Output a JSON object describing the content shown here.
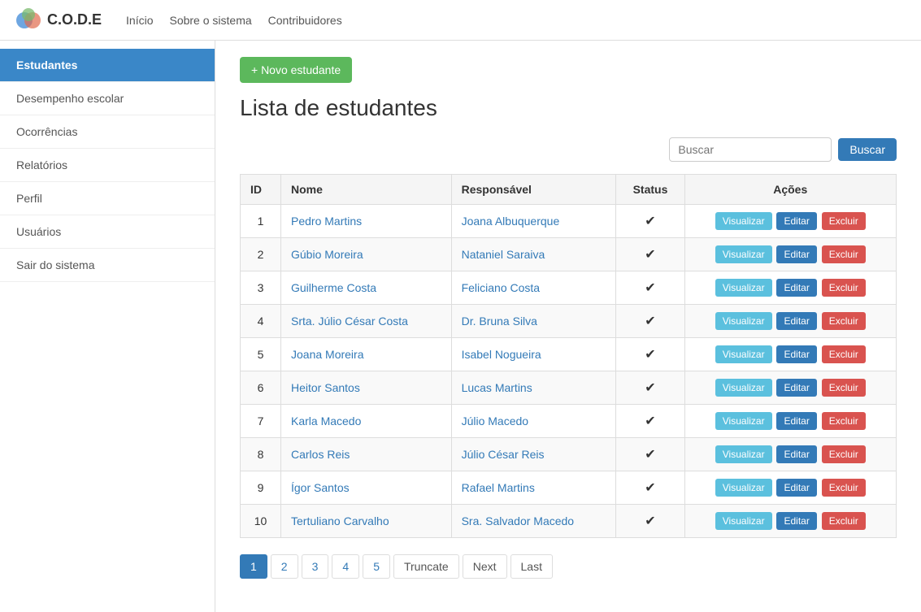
{
  "app": {
    "logo_text": "C.O.D.E"
  },
  "topnav": {
    "links": [
      {
        "label": "Início",
        "name": "inicio-link"
      },
      {
        "label": "Sobre o sistema",
        "name": "sobre-link"
      },
      {
        "label": "Contribuidores",
        "name": "contribuidores-link"
      }
    ]
  },
  "sidebar": {
    "items": [
      {
        "label": "Estudantes",
        "active": true,
        "name": "sidebar-item-estudantes"
      },
      {
        "label": "Desempenho escolar",
        "active": false,
        "name": "sidebar-item-desempenho"
      },
      {
        "label": "Ocorrências",
        "active": false,
        "name": "sidebar-item-ocorrencias"
      },
      {
        "label": "Relatórios",
        "active": false,
        "name": "sidebar-item-relatorios"
      },
      {
        "label": "Perfil",
        "active": false,
        "name": "sidebar-item-perfil"
      },
      {
        "label": "Usuários",
        "active": false,
        "name": "sidebar-item-usuarios"
      },
      {
        "label": "Sair do sistema",
        "active": false,
        "name": "sidebar-item-sair"
      }
    ]
  },
  "main": {
    "new_student_btn": "+ Novo estudante",
    "page_title": "Lista de estudantes",
    "search_placeholder": "Buscar",
    "search_btn": "Buscar",
    "table": {
      "headers": [
        "ID",
        "Nome",
        "Responsável",
        "Status",
        "Ações"
      ],
      "rows": [
        {
          "id": 1,
          "nome": "Pedro Martins",
          "responsavel": "Joana Albuquerque",
          "status": true
        },
        {
          "id": 2,
          "nome": "Gúbio Moreira",
          "responsavel": "Nataniel Saraiva",
          "status": true
        },
        {
          "id": 3,
          "nome": "Guilherme Costa",
          "responsavel": "Feliciano Costa",
          "status": true
        },
        {
          "id": 4,
          "nome": "Srta. Júlio César Costa",
          "responsavel": "Dr. Bruna Silva",
          "status": true
        },
        {
          "id": 5,
          "nome": "Joana Moreira",
          "responsavel": "Isabel Nogueira",
          "status": true
        },
        {
          "id": 6,
          "nome": "Heitor Santos",
          "responsavel": "Lucas Martins",
          "status": true
        },
        {
          "id": 7,
          "nome": "Karla Macedo",
          "responsavel": "Júlio Macedo",
          "status": true
        },
        {
          "id": 8,
          "nome": "Carlos Reis",
          "responsavel": "Júlio César Reis",
          "status": true
        },
        {
          "id": 9,
          "nome": "Ígor Santos",
          "responsavel": "Rafael Martins",
          "status": true
        },
        {
          "id": 10,
          "nome": "Tertuliano Carvalho",
          "responsavel": "Sra. Salvador Macedo",
          "status": true
        }
      ],
      "btn_visualizar": "Visualizar",
      "btn_editar": "Editar",
      "btn_excluir": "Excluir"
    },
    "pagination": {
      "pages": [
        "1",
        "2",
        "3",
        "4",
        "5"
      ],
      "truncate": "Truncate",
      "next": "Next",
      "last": "Last",
      "active_page": "1"
    }
  }
}
